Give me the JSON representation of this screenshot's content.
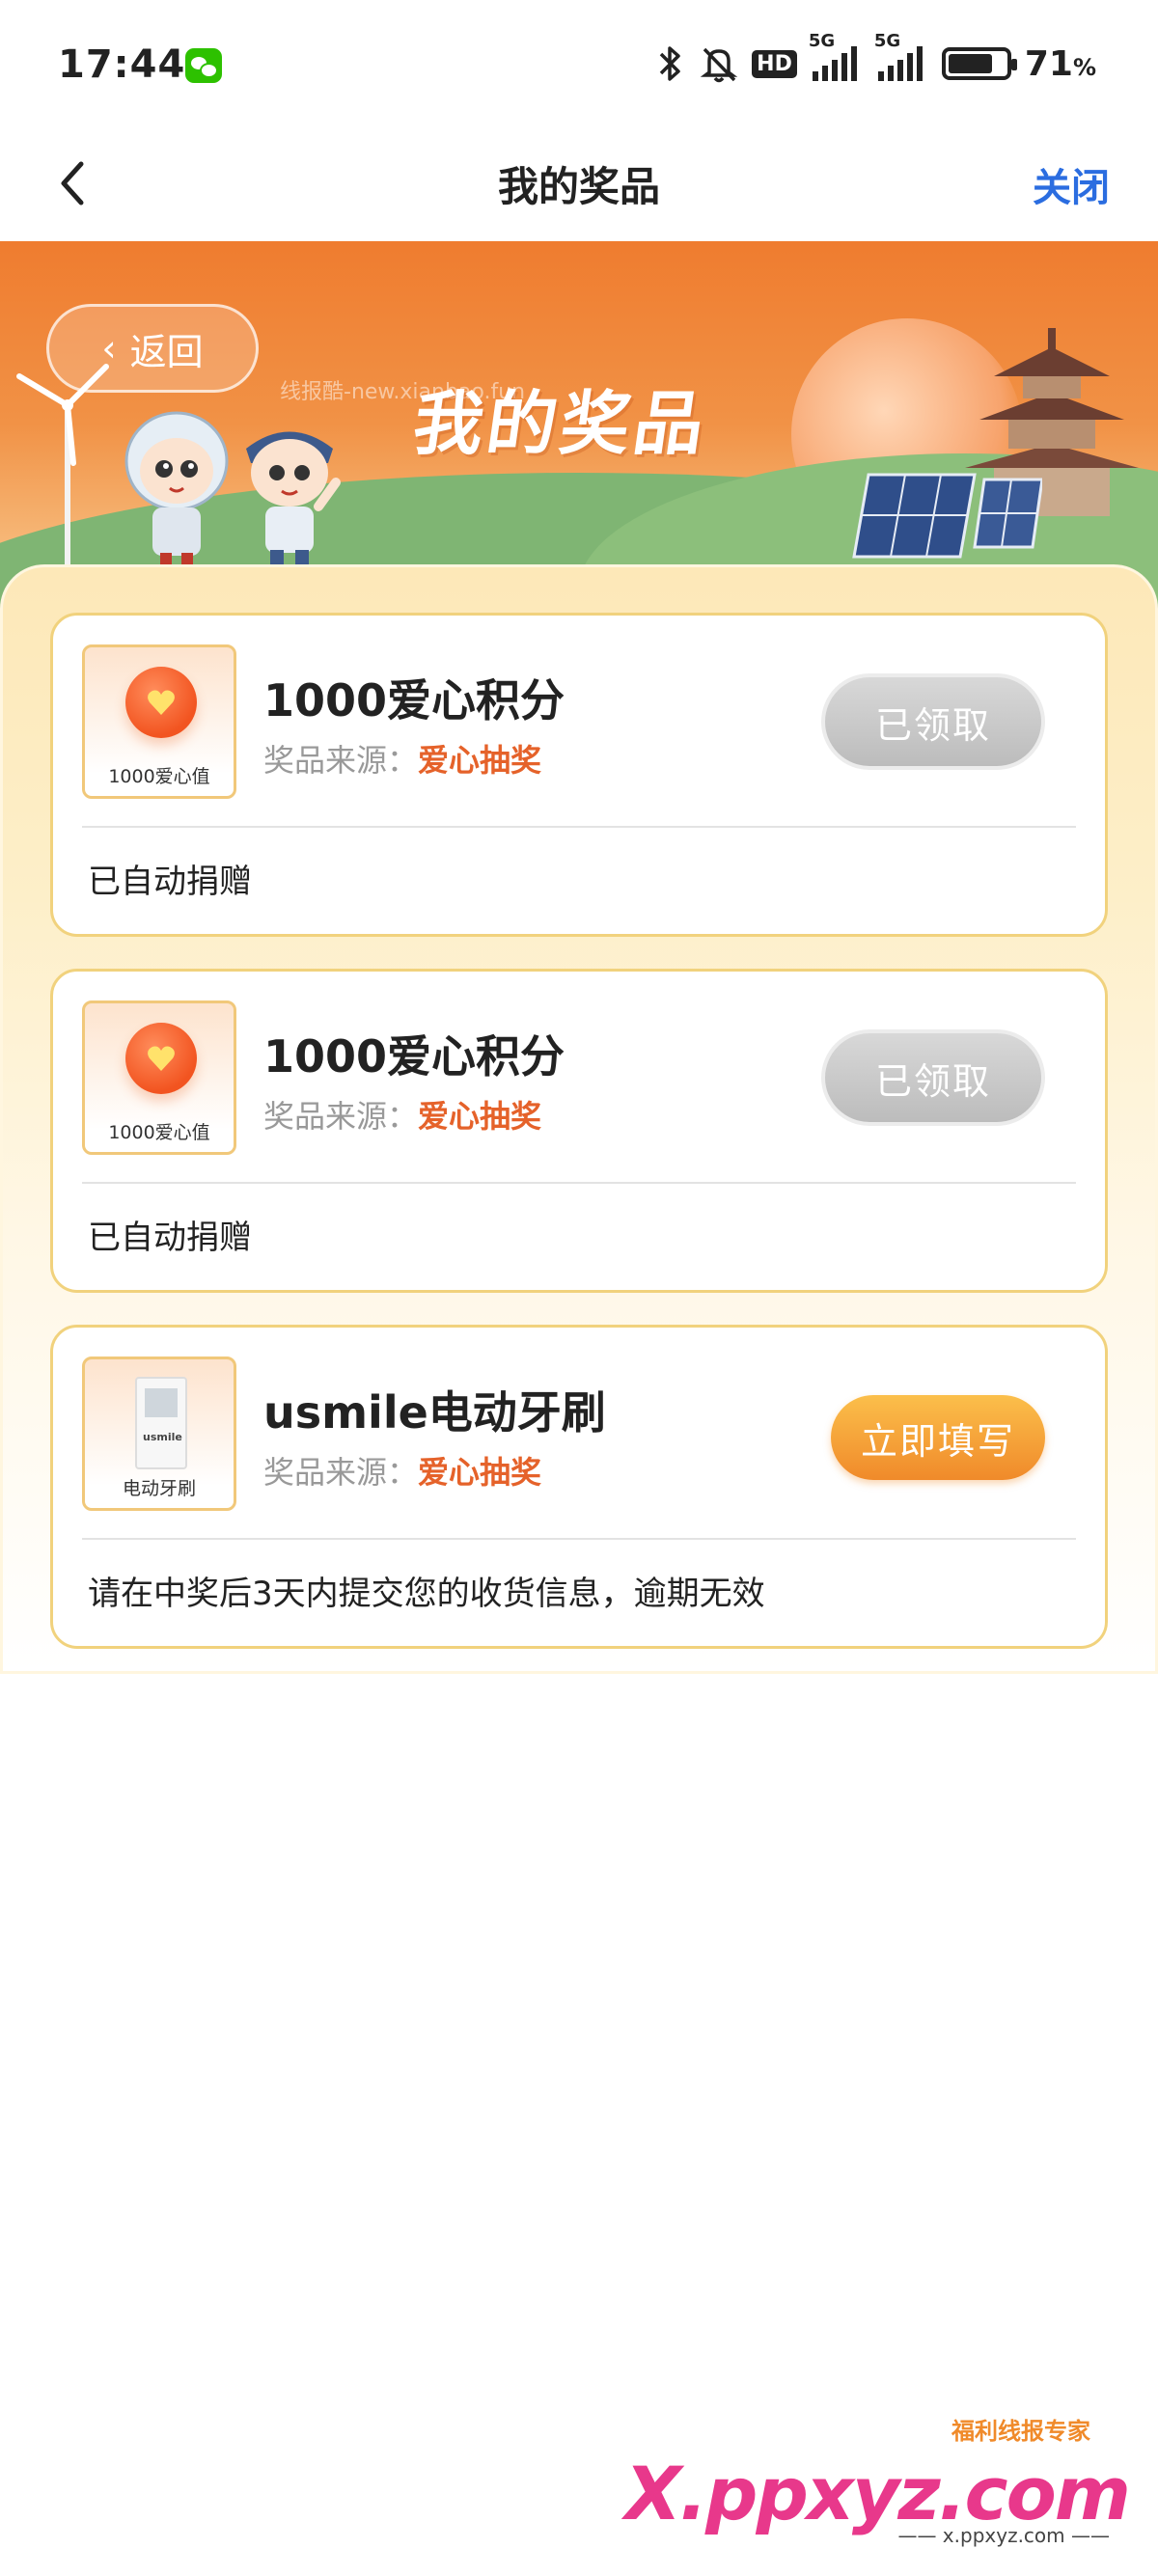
{
  "status": {
    "time": "17:44",
    "hd": "HD",
    "net1": "5G",
    "net2": "5G",
    "battery": "71",
    "battery_unit": "%",
    "battery_level": 0.71
  },
  "nav": {
    "title": "我的奖品",
    "close": "关闭"
  },
  "banner": {
    "back_label": "返回",
    "title": "我的奖品",
    "watermark": "线报酷-new.xianbao.fun"
  },
  "prizes": [
    {
      "thumb_label": "1000爱心值",
      "name": "1000爱心积分",
      "source_label": "奖品来源：",
      "source_value": "爱心抽奖",
      "action": "已领取",
      "note": "已自动捐赠"
    },
    {
      "thumb_label": "1000爱心值",
      "name": "1000爱心积分",
      "source_label": "奖品来源：",
      "source_value": "爱心抽奖",
      "action": "已领取",
      "note": "已自动捐赠"
    },
    {
      "thumb_label": "电动牙刷",
      "thumb_logo": "usmile",
      "name": "usmile电动牙刷",
      "source_label": "奖品来源：",
      "source_value": "爱心抽奖",
      "action": "立即填写",
      "note": "请在中奖后3天内提交您的收货信息，逾期无效"
    }
  ],
  "footer": {
    "tag": "福利线报专家",
    "brand": "X.ppxyz.com",
    "sub": "—— x.ppxyz.com ——"
  },
  "colors": {
    "accent": "#e5622a",
    "link": "#2b6de0",
    "banner": "#ef7c2f",
    "card_border": "#f1d27d"
  }
}
